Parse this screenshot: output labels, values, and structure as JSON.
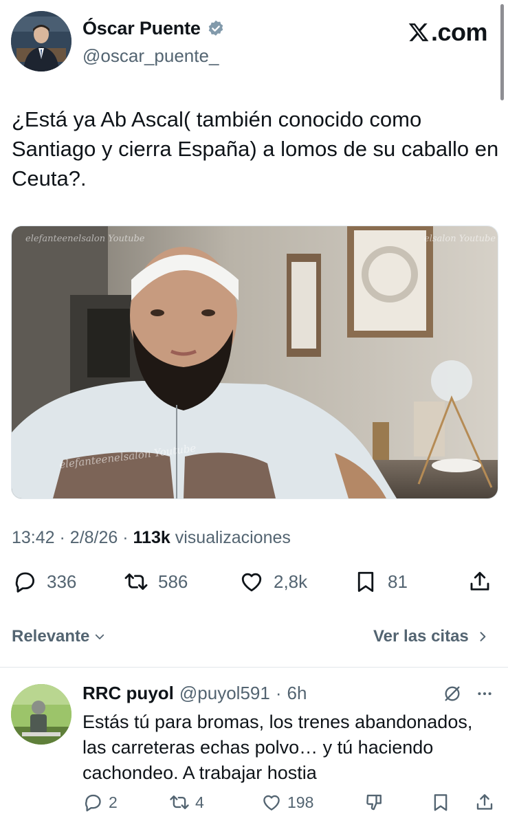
{
  "tweet": {
    "author_name": "Óscar Puente",
    "author_handle": "@oscar_puente_",
    "brand": ".com",
    "text": "¿Está ya Ab Ascal( también conocido como Santiago y cierra España) a lomos de su caballo en Ceuta?.",
    "media_watermark_top_left": "elefanteenelsalon Youtube",
    "media_watermark_top_right": "elsalon Youtube",
    "media_watermark_center": "elefanteenelsalon Youtube",
    "time": "13:42",
    "date": "2/8/26",
    "views_count": "113k",
    "views_label": "visualizaciones",
    "stats": {
      "replies": "336",
      "reposts": "586",
      "likes": "2,8k",
      "bookmarks": "81"
    }
  },
  "filters": {
    "sort_label": "Relevante",
    "quotes_label": "Ver las citas"
  },
  "reply": {
    "author_name": "RRC puyol",
    "author_handle": "@puyol591",
    "separator": "·",
    "time_ago": "6h",
    "text": "Estás tú para bromas, los trenes abandonados, las carreteras echas polvo… y tú haciendo cachondeo. A trabajar hostia",
    "stats": {
      "replies": "2",
      "reposts": "4",
      "likes": "198"
    }
  },
  "icons": {
    "verified": "verified-badge-icon",
    "x_logo": "x-logo-icon",
    "reply": "comment-icon",
    "repost": "repost-icon",
    "like": "heart-icon",
    "bookmark": "bookmark-icon",
    "share": "share-icon",
    "chevron_down": "chevron-down-icon",
    "chevron_right": "chevron-right-icon",
    "grok": "grok-icon",
    "more": "more-icon",
    "dislike": "dislike-icon"
  },
  "colors": {
    "text_primary": "#0f1419",
    "text_secondary": "#536471",
    "verified": "#829aab"
  }
}
